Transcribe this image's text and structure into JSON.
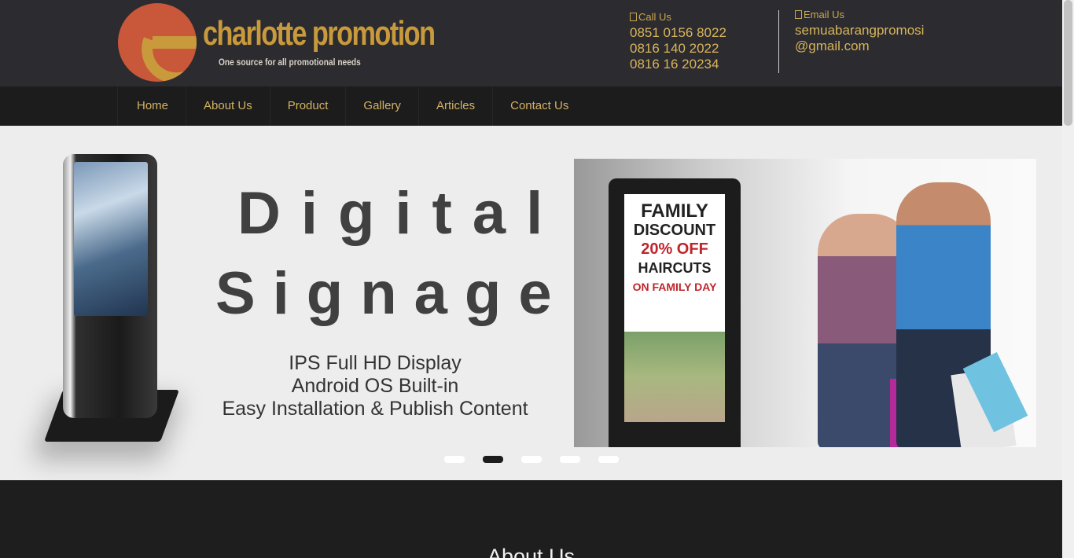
{
  "brand": {
    "name": "charlotte promotion",
    "tagline": "One source for all  promotional needs",
    "colors": {
      "gold": "#c99a3c",
      "orange": "#c9573a",
      "header_bg": "#2c2b30"
    }
  },
  "contact": {
    "call_label": "Call Us",
    "phones": [
      "0851 0156 8022",
      "0816 140 2022",
      "0816 16 20234"
    ],
    "email_label": "Email Us",
    "email_line1": "semuabarangpromosi",
    "email_line2": "@gmail.com",
    "call_icon": "phone-icon",
    "email_icon": "envelope-icon"
  },
  "nav": {
    "items": [
      "Home",
      "About Us",
      "Product",
      "Gallery",
      "Articles",
      "Contact Us"
    ]
  },
  "slider": {
    "title_line1": "Digital",
    "title_line2": "Signage",
    "features": [
      "IPS Full HD Display",
      "Android OS Built-in",
      "Easy Installation & Publish Content"
    ],
    "promo": [
      "FAMILY",
      "DISCOUNT",
      "20% OFF",
      "HAIRCUTS",
      "ON FAMILY DAY"
    ],
    "dot_count": 5,
    "active_dot": 2
  },
  "section": {
    "heading": "About Us"
  }
}
